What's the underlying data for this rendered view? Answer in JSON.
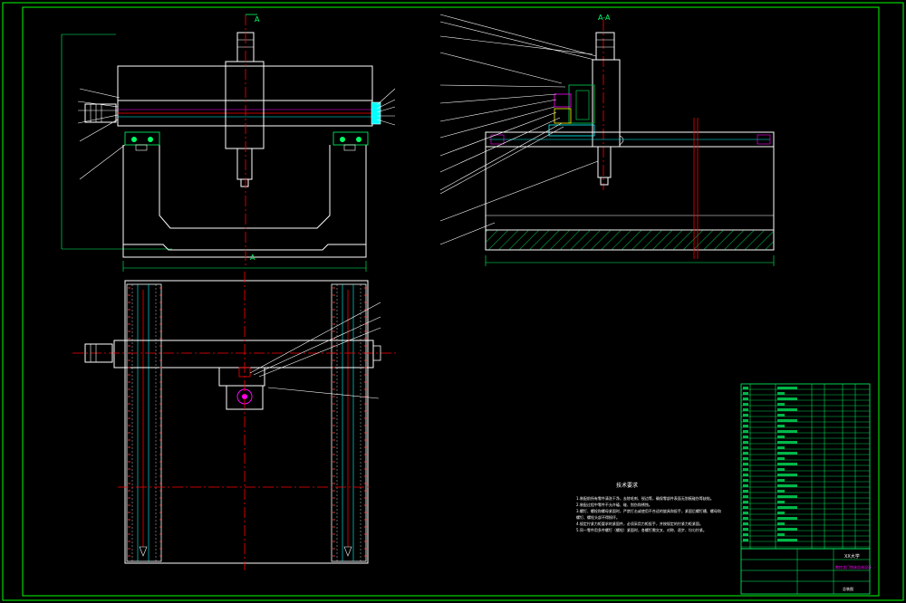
{
  "drawing": {
    "background": "#000000",
    "colors": {
      "frame": "#00ff00",
      "outline": "#ffffff",
      "centerline": "#ff0000",
      "dimension": "#00ff66",
      "cyan": "#00ffff",
      "magenta": "#ff00ff",
      "hatch": "#00aa44",
      "yellow": "#ffff00"
    },
    "section_label_top": "A",
    "section_label_bottom": "A",
    "section_view_title": "A-A",
    "notes_title": "技术要求",
    "notes_lines": [
      "1.装配前所有零件清洗干净，去除毛刺、锐边等，确保零部件表面无划痕碰伤等缺陷。",
      "2.装配过程中零件不允许磕、碰、划伤和锈蚀。",
      "3.螺钉、螺栓和螺母紧固时，严禁打击或使用不合适的旋具和扳手，紧固后螺钉槽、螺母和",
      "螺钉、螺栓头部不得损坏。",
      "4.规定拧紧力矩要求的紧固件，必须采用力矩扳手，并按规定的拧紧力矩紧固。",
      "5.同一零件用多件螺钉（螺栓）紧固时，各螺钉需交叉、对称、逐步、均匀拧紧。"
    ],
    "title_block": {
      "school": "XX大学",
      "drawing_title": "数控龙门铣床总体设计",
      "drawing_no": "总装图"
    }
  }
}
